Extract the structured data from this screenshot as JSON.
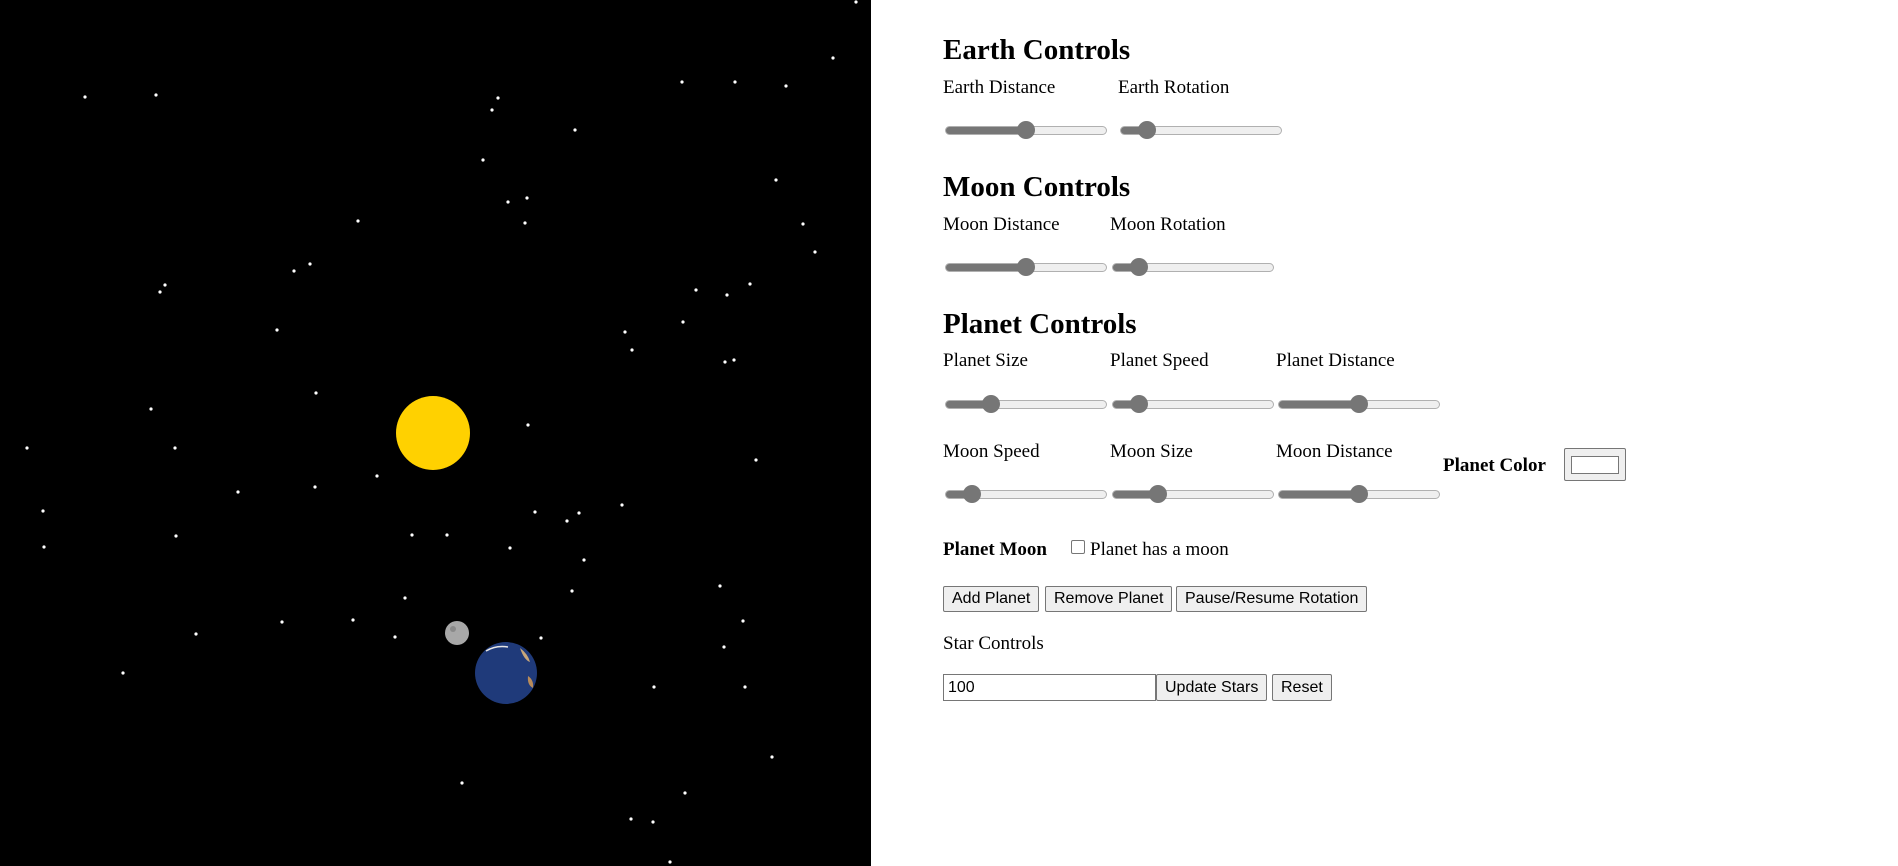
{
  "colors": {
    "space": "#000000",
    "sun": "#FFD100",
    "earth": "#1F3A7A",
    "moon": "#A8A8A8",
    "star": "#FFFFFF",
    "slider_fill": "#767676"
  },
  "earth": {
    "heading": "Earth Controls",
    "distance_label": "Earth Distance",
    "distance_value": 0.5,
    "rotation_label": "Earth Rotation",
    "rotation_value": 0.12
  },
  "moon": {
    "heading": "Moon Controls",
    "distance_label": "Moon Distance",
    "distance_value": 0.5,
    "rotation_label": "Moon Rotation",
    "rotation_value": 0.12
  },
  "planet": {
    "heading": "Planet Controls",
    "size_label": "Planet Size",
    "size_value": 0.25,
    "speed_label": "Planet Speed",
    "speed_value": 0.12,
    "distance_label": "Planet Distance",
    "distance_value": 0.5,
    "moon_speed_label": "Moon Speed",
    "moon_speed_value": 0.12,
    "moon_size_label": "Moon Size",
    "moon_size_value": 0.25,
    "moon_distance_label": "Moon Distance",
    "moon_distance_value": 0.5,
    "color_label": "Planet Color",
    "color_value": "#ffffff",
    "moon_heading": "Planet Moon",
    "has_moon_label": "Planet has a moon",
    "has_moon": false,
    "add_button": "Add Planet",
    "remove_button": "Remove Planet",
    "pause_button": "Pause/Resume Rotation"
  },
  "stars": {
    "label": "Star Controls",
    "count_value": "100",
    "update_button": "Update Stars",
    "reset_button": "Reset"
  }
}
